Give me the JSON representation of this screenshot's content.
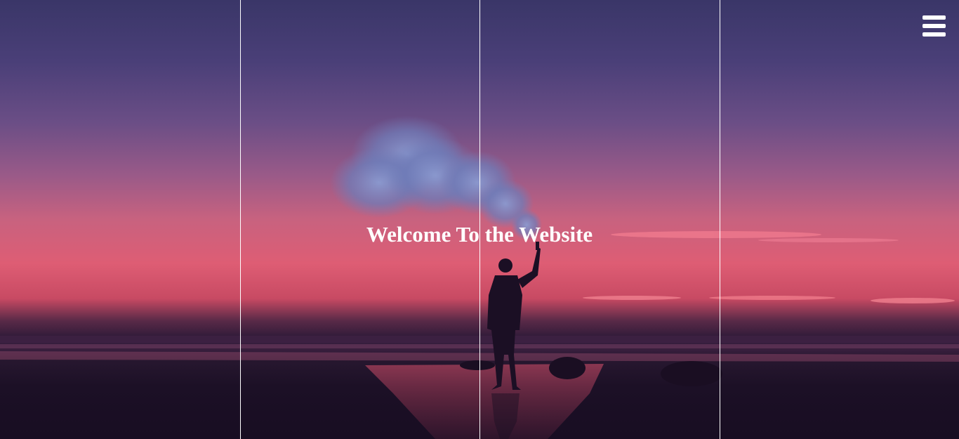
{
  "hero": {
    "heading": "Welcome To the Website"
  },
  "menu": {
    "icon": "hamburger-menu-icon"
  },
  "colors": {
    "text": "#ffffff",
    "sky_top": "#3a3668",
    "sky_glow": "#de5d74",
    "ground": "#1c1026"
  }
}
